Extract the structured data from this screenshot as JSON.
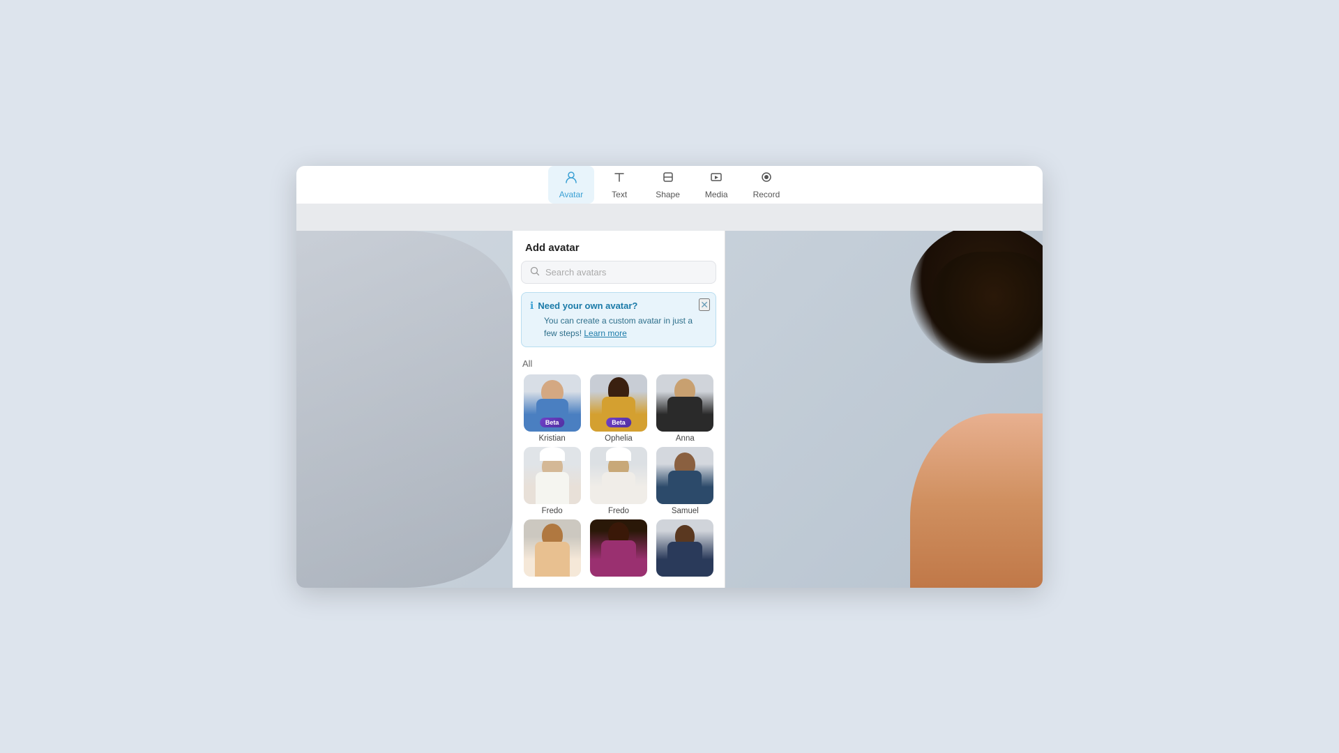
{
  "toolbar": {
    "tabs": [
      {
        "id": "avatar",
        "label": "Avatar",
        "active": true,
        "icon": "person"
      },
      {
        "id": "text",
        "label": "Text",
        "active": false,
        "icon": "text"
      },
      {
        "id": "shape",
        "label": "Shape",
        "active": false,
        "icon": "shape"
      },
      {
        "id": "media",
        "label": "Media",
        "active": false,
        "icon": "media"
      },
      {
        "id": "record",
        "label": "Record",
        "active": false,
        "icon": "record"
      }
    ]
  },
  "panel": {
    "title": "Add avatar",
    "search_placeholder": "Search avatars",
    "section_label": "All",
    "info_banner": {
      "title": "Need your own avatar?",
      "body": "You can create a custom avatar in just a few steps!",
      "link_text": "Learn more"
    },
    "avatars": [
      {
        "name": "Kristian",
        "beta": true,
        "style": "kristian"
      },
      {
        "name": "Ophelia",
        "beta": true,
        "style": "ophelia"
      },
      {
        "name": "Anna",
        "beta": false,
        "style": "anna"
      },
      {
        "name": "Fredo",
        "beta": false,
        "style": "fredo1"
      },
      {
        "name": "Fredo",
        "beta": false,
        "style": "fredo2"
      },
      {
        "name": "Samuel",
        "beta": false,
        "style": "samuel"
      },
      {
        "name": "",
        "beta": false,
        "style": "woman1"
      },
      {
        "name": "",
        "beta": false,
        "style": "woman2"
      },
      {
        "name": "",
        "beta": false,
        "style": "woman3"
      }
    ]
  },
  "colors": {
    "active_tab": "#3aa0d4",
    "active_tab_bg": "#e8f4fb",
    "banner_bg": "#e8f4fb",
    "beta_badge": "#7040c8"
  }
}
